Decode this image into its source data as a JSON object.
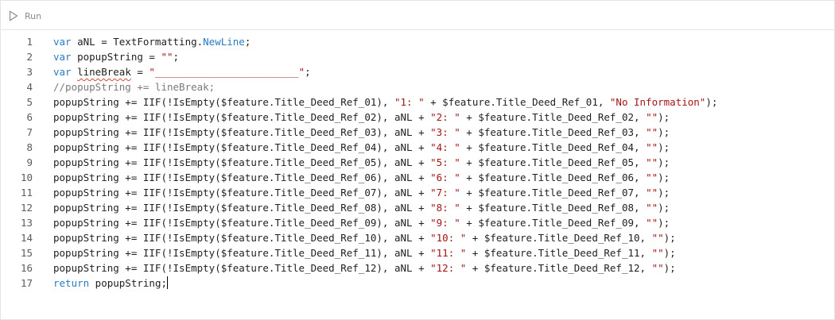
{
  "toolbar": {
    "run_label": "Run",
    "run_icon": "play-outline-icon"
  },
  "colors": {
    "keyword": "#2a7bc2",
    "string": "#a31515",
    "comment": "#7a7a7a",
    "plain": "#1f1f1f",
    "line_number": "#5b5b5b",
    "squiggle": "#d04a2e"
  },
  "editor": {
    "lines": [
      {
        "number": "1",
        "tokens": [
          {
            "t": "var",
            "c": "keyword"
          },
          {
            "t": " aNL = TextFormatting.",
            "c": "plain"
          },
          {
            "t": "NewLine",
            "c": "keyword"
          },
          {
            "t": ";",
            "c": "plain"
          }
        ]
      },
      {
        "number": "2",
        "tokens": [
          {
            "t": "var",
            "c": "keyword"
          },
          {
            "t": " popupString = ",
            "c": "plain"
          },
          {
            "t": "\"\"",
            "c": "string"
          },
          {
            "t": ";",
            "c": "plain"
          }
        ]
      },
      {
        "number": "3",
        "tokens": [
          {
            "t": "var",
            "c": "keyword"
          },
          {
            "t": " ",
            "c": "plain"
          },
          {
            "t": "lineBreak",
            "c": "plain",
            "squiggle": true
          },
          {
            "t": " = ",
            "c": "plain"
          },
          {
            "t": "\"________________________\"",
            "c": "string"
          },
          {
            "t": ";",
            "c": "plain"
          }
        ]
      },
      {
        "number": "4",
        "tokens": [
          {
            "t": "//popupString += lineBreak;",
            "c": "comment"
          }
        ]
      },
      {
        "number": "5",
        "tokens": [
          {
            "t": "popupString += IIF(!IsEmpty($feature.Title_Deed_Ref_01), ",
            "c": "plain"
          },
          {
            "t": "\"1: \"",
            "c": "string"
          },
          {
            "t": " + $feature.Title_Deed_Ref_01, ",
            "c": "plain"
          },
          {
            "t": "\"No Information\"",
            "c": "string"
          },
          {
            "t": ");",
            "c": "plain"
          }
        ]
      },
      {
        "number": "6",
        "tokens": [
          {
            "t": "popupString += IIF(!IsEmpty($feature.Title_Deed_Ref_02), aNL + ",
            "c": "plain"
          },
          {
            "t": "\"2: \"",
            "c": "string"
          },
          {
            "t": " + $feature.Title_Deed_Ref_02, ",
            "c": "plain"
          },
          {
            "t": "\"\"",
            "c": "string"
          },
          {
            "t": ");",
            "c": "plain"
          }
        ]
      },
      {
        "number": "7",
        "tokens": [
          {
            "t": "popupString += IIF(!IsEmpty($feature.Title_Deed_Ref_03), aNL + ",
            "c": "plain"
          },
          {
            "t": "\"3: \"",
            "c": "string"
          },
          {
            "t": " + $feature.Title_Deed_Ref_03, ",
            "c": "plain"
          },
          {
            "t": "\"\"",
            "c": "string"
          },
          {
            "t": ");",
            "c": "plain"
          }
        ]
      },
      {
        "number": "8",
        "tokens": [
          {
            "t": "popupString += IIF(!IsEmpty($feature.Title_Deed_Ref_04), aNL + ",
            "c": "plain"
          },
          {
            "t": "\"4: \"",
            "c": "string"
          },
          {
            "t": " + $feature.Title_Deed_Ref_04, ",
            "c": "plain"
          },
          {
            "t": "\"\"",
            "c": "string"
          },
          {
            "t": ");",
            "c": "plain"
          }
        ]
      },
      {
        "number": "9",
        "tokens": [
          {
            "t": "popupString += IIF(!IsEmpty($feature.Title_Deed_Ref_05), aNL + ",
            "c": "plain"
          },
          {
            "t": "\"5: \"",
            "c": "string"
          },
          {
            "t": " + $feature.Title_Deed_Ref_05, ",
            "c": "plain"
          },
          {
            "t": "\"\"",
            "c": "string"
          },
          {
            "t": ");",
            "c": "plain"
          }
        ]
      },
      {
        "number": "10",
        "tokens": [
          {
            "t": "popupString += IIF(!IsEmpty($feature.Title_Deed_Ref_06), aNL + ",
            "c": "plain"
          },
          {
            "t": "\"6: \"",
            "c": "string"
          },
          {
            "t": " + $feature.Title_Deed_Ref_06, ",
            "c": "plain"
          },
          {
            "t": "\"\"",
            "c": "string"
          },
          {
            "t": ");",
            "c": "plain"
          }
        ]
      },
      {
        "number": "11",
        "tokens": [
          {
            "t": "popupString += IIF(!IsEmpty($feature.Title_Deed_Ref_07), aNL + ",
            "c": "plain"
          },
          {
            "t": "\"7: \"",
            "c": "string"
          },
          {
            "t": " + $feature.Title_Deed_Ref_07, ",
            "c": "plain"
          },
          {
            "t": "\"\"",
            "c": "string"
          },
          {
            "t": ");",
            "c": "plain"
          }
        ]
      },
      {
        "number": "12",
        "tokens": [
          {
            "t": "popupString += IIF(!IsEmpty($feature.Title_Deed_Ref_08), aNL + ",
            "c": "plain"
          },
          {
            "t": "\"8: \"",
            "c": "string"
          },
          {
            "t": " + $feature.Title_Deed_Ref_08, ",
            "c": "plain"
          },
          {
            "t": "\"\"",
            "c": "string"
          },
          {
            "t": ");",
            "c": "plain"
          }
        ]
      },
      {
        "number": "13",
        "tokens": [
          {
            "t": "popupString += IIF(!IsEmpty($feature.Title_Deed_Ref_09), aNL + ",
            "c": "plain"
          },
          {
            "t": "\"9: \"",
            "c": "string"
          },
          {
            "t": " + $feature.Title_Deed_Ref_09, ",
            "c": "plain"
          },
          {
            "t": "\"\"",
            "c": "string"
          },
          {
            "t": ");",
            "c": "plain"
          }
        ]
      },
      {
        "number": "14",
        "tokens": [
          {
            "t": "popupString += IIF(!IsEmpty($feature.Title_Deed_Ref_10), aNL + ",
            "c": "plain"
          },
          {
            "t": "\"10: \"",
            "c": "string"
          },
          {
            "t": " + $feature.Title_Deed_Ref_10, ",
            "c": "plain"
          },
          {
            "t": "\"\"",
            "c": "string"
          },
          {
            "t": ");",
            "c": "plain"
          }
        ]
      },
      {
        "number": "15",
        "tokens": [
          {
            "t": "popupString += IIF(!IsEmpty($feature.Title_Deed_Ref_11), aNL + ",
            "c": "plain"
          },
          {
            "t": "\"11: \"",
            "c": "string"
          },
          {
            "t": " + $feature.Title_Deed_Ref_11, ",
            "c": "plain"
          },
          {
            "t": "\"\"",
            "c": "string"
          },
          {
            "t": ");",
            "c": "plain"
          }
        ]
      },
      {
        "number": "16",
        "tokens": [
          {
            "t": "popupString += IIF(!IsEmpty($feature.Title_Deed_Ref_12), aNL + ",
            "c": "plain"
          },
          {
            "t": "\"12: \"",
            "c": "string"
          },
          {
            "t": " + $feature.Title_Deed_Ref_12, ",
            "c": "plain"
          },
          {
            "t": "\"\"",
            "c": "string"
          },
          {
            "t": ");",
            "c": "plain"
          }
        ]
      },
      {
        "number": "17",
        "tokens": [
          {
            "t": "return",
            "c": "keyword"
          },
          {
            "t": " popupString;",
            "c": "plain"
          }
        ],
        "cursor": true
      }
    ]
  }
}
